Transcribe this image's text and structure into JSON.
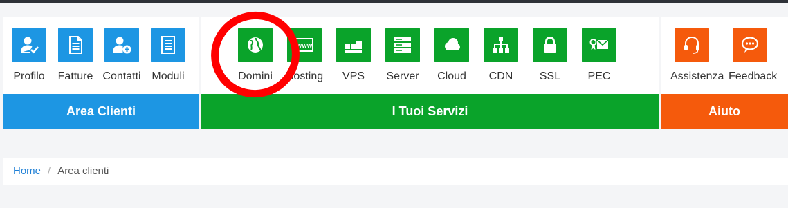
{
  "nav": {
    "clienti": {
      "title": "Area Clienti",
      "color": "#1d96e3",
      "items": [
        {
          "label": "Profilo",
          "icon": "user-check-icon"
        },
        {
          "label": "Fatture",
          "icon": "document-icon"
        },
        {
          "label": "Contatti",
          "icon": "user-add-icon"
        },
        {
          "label": "Moduli",
          "icon": "form-icon"
        }
      ]
    },
    "servizi": {
      "title": "I Tuoi Servizi",
      "color": "#0aa32a",
      "items": [
        {
          "label": "Domini",
          "icon": "globe-icon"
        },
        {
          "label": "Hosting",
          "icon": "hosting-icon",
          "tile_text": "WWW"
        },
        {
          "label": "VPS",
          "icon": "vps-icon"
        },
        {
          "label": "Server",
          "icon": "server-icon"
        },
        {
          "label": "Cloud",
          "icon": "cloud-icon"
        },
        {
          "label": "CDN",
          "icon": "network-icon"
        },
        {
          "label": "SSL",
          "icon": "lock-icon"
        },
        {
          "label": "PEC",
          "icon": "certified-mail-icon"
        }
      ]
    },
    "aiuto": {
      "title": "Aiuto",
      "color": "#f55a0c",
      "items": [
        {
          "label": "Assistenza",
          "icon": "headset-icon"
        },
        {
          "label": "Feedback",
          "icon": "speech-bubble-icon"
        }
      ]
    }
  },
  "annotation": {
    "color": "#ff0000"
  },
  "breadcrumb": {
    "home": "Home",
    "separator": "/",
    "current": "Area clienti"
  }
}
